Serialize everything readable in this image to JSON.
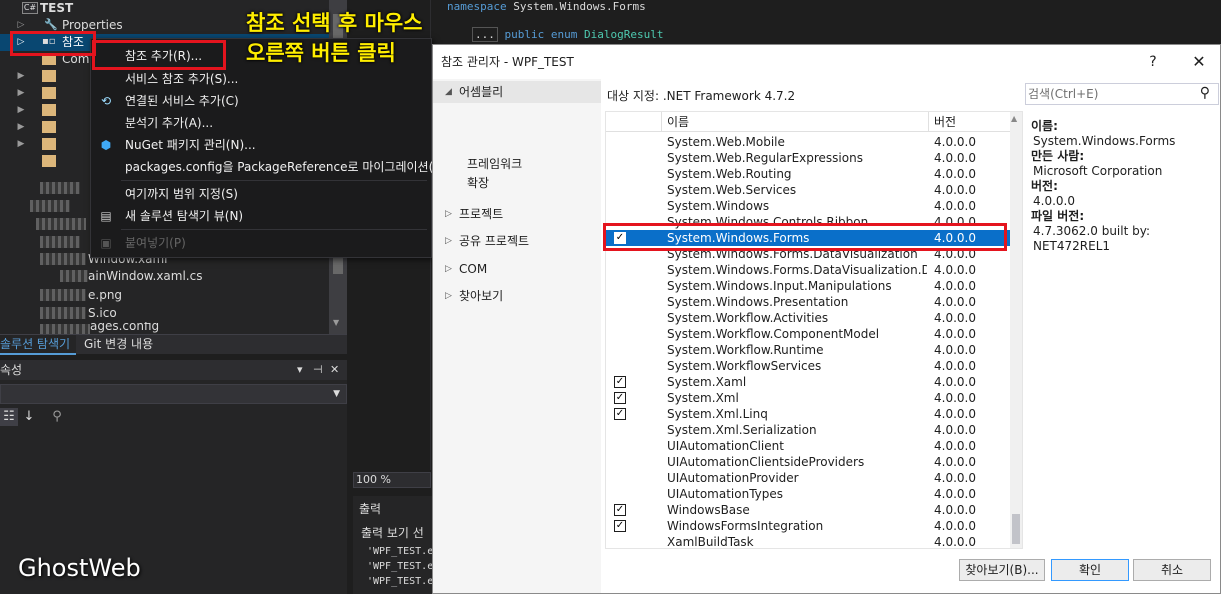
{
  "solution_explorer": {
    "project_name": "TEST",
    "project_badge": "C#",
    "items": {
      "properties": "Properties",
      "references": "참조",
      "common": "Com",
      "mainwindow_xaml": "Window.xaml",
      "mainwindow_cs": "ainWindow.xaml.cs",
      "png": "e.png",
      "ico": "S.ico",
      "packages": "ages.config"
    },
    "tabs": {
      "solution": "솔루션 탐색기",
      "git": "Git 변경 내용"
    }
  },
  "properties_panel": {
    "title": "속성"
  },
  "editor": {
    "namespace_keyword": "namespace",
    "namespace_name": "System.Windows.Forms",
    "enum_prefix": "...",
    "enum_keywords": "public enum",
    "enum_name": "DialogResult",
    "zoom": "100 %",
    "output_title": "출력",
    "output_source": "출력 보기 선",
    "output_lines": [
      "'WPF_TEST.e",
      "'WPF_TEST.e",
      "'WPF_TEST.e"
    ]
  },
  "context_menu": {
    "items": [
      {
        "label": "참조 추가(R)...",
        "icon": ""
      },
      {
        "label": "서비스 참조 추가(S)...",
        "icon": ""
      },
      {
        "label": "연결된 서비스 추가(C)",
        "icon": "connected-service-icon"
      },
      {
        "label": "분석기 추가(A)...",
        "icon": ""
      },
      {
        "label": "NuGet 패키지 관리(N)...",
        "icon": "nuget-icon"
      },
      {
        "label": "packages.config을 PackageReference로 마이그레이션(M)",
        "icon": ""
      },
      {
        "label": "여기까지 범위 지정(S)",
        "icon": ""
      },
      {
        "label": "새 솔루션 탐색기 뷰(N)",
        "icon": "new-explorer-view-icon"
      },
      {
        "label": "붙여넣기(P)",
        "icon": "paste-icon"
      }
    ]
  },
  "annotation": {
    "line1": "참조 선택 후 마우스",
    "line2": "오른쪽 버튼 클릭"
  },
  "watermark": "GhostWeb",
  "dialog": {
    "title": "참조 관리자 - WPF_TEST",
    "help": "?",
    "close": "✕",
    "target_label": "대상 지정: .NET Framework 4.7.2",
    "search_placeholder": "검색(Ctrl+E)",
    "nav": {
      "assemblies": "어셈블리",
      "framework": "프레임워크",
      "extensions": "확장",
      "projects": "프로젝트",
      "shared_projects": "공유 프로젝트",
      "com": "COM",
      "browse": "찾아보기"
    },
    "columns": {
      "name": "이름",
      "version": "버전"
    },
    "rows": [
      {
        "name": "System.Web.Mobile",
        "version": "4.0.0.0",
        "checked": false,
        "selected": false
      },
      {
        "name": "System.Web.RegularExpressions",
        "version": "4.0.0.0",
        "checked": false,
        "selected": false
      },
      {
        "name": "System.Web.Routing",
        "version": "4.0.0.0",
        "checked": false,
        "selected": false
      },
      {
        "name": "System.Web.Services",
        "version": "4.0.0.0",
        "checked": false,
        "selected": false
      },
      {
        "name": "System.Windows",
        "version": "4.0.0.0",
        "checked": false,
        "selected": false
      },
      {
        "name": "System.Windows.Controls.Ribbon",
        "version": "4.0.0.0",
        "checked": false,
        "selected": false
      },
      {
        "name": "System.Windows.Forms",
        "version": "4.0.0.0",
        "checked": true,
        "selected": true
      },
      {
        "name": "System.Windows.Forms.DataVisualization",
        "version": "4.0.0.0",
        "checked": false,
        "selected": false
      },
      {
        "name": "System.Windows.Forms.DataVisualization.Des...",
        "version": "4.0.0.0",
        "checked": false,
        "selected": false
      },
      {
        "name": "System.Windows.Input.Manipulations",
        "version": "4.0.0.0",
        "checked": false,
        "selected": false
      },
      {
        "name": "System.Windows.Presentation",
        "version": "4.0.0.0",
        "checked": false,
        "selected": false
      },
      {
        "name": "System.Workflow.Activities",
        "version": "4.0.0.0",
        "checked": false,
        "selected": false
      },
      {
        "name": "System.Workflow.ComponentModel",
        "version": "4.0.0.0",
        "checked": false,
        "selected": false
      },
      {
        "name": "System.Workflow.Runtime",
        "version": "4.0.0.0",
        "checked": false,
        "selected": false
      },
      {
        "name": "System.WorkflowServices",
        "version": "4.0.0.0",
        "checked": false,
        "selected": false
      },
      {
        "name": "System.Xaml",
        "version": "4.0.0.0",
        "checked": true,
        "selected": false
      },
      {
        "name": "System.Xml",
        "version": "4.0.0.0",
        "checked": true,
        "selected": false
      },
      {
        "name": "System.Xml.Linq",
        "version": "4.0.0.0",
        "checked": true,
        "selected": false
      },
      {
        "name": "System.Xml.Serialization",
        "version": "4.0.0.0",
        "checked": false,
        "selected": false
      },
      {
        "name": "UIAutomationClient",
        "version": "4.0.0.0",
        "checked": false,
        "selected": false
      },
      {
        "name": "UIAutomationClientsideProviders",
        "version": "4.0.0.0",
        "checked": false,
        "selected": false
      },
      {
        "name": "UIAutomationProvider",
        "version": "4.0.0.0",
        "checked": false,
        "selected": false
      },
      {
        "name": "UIAutomationTypes",
        "version": "4.0.0.0",
        "checked": false,
        "selected": false
      },
      {
        "name": "WindowsBase",
        "version": "4.0.0.0",
        "checked": true,
        "selected": false
      },
      {
        "name": "WindowsFormsIntegration",
        "version": "4.0.0.0",
        "checked": true,
        "selected": false
      },
      {
        "name": "XamlBuildTask",
        "version": "4.0.0.0",
        "checked": false,
        "selected": false
      }
    ],
    "details": {
      "name_label": "이름:",
      "name_value": "System.Windows.Forms",
      "author_label": "만든 사람:",
      "author_value": "Microsoft Corporation",
      "version_label": "버전:",
      "version_value": "4.0.0.0",
      "file_version_label": "파일 버전:",
      "file_version_value": "4.7.3062.0 built by: NET472REL1"
    },
    "buttons": {
      "browse": "찾아보기(B)...",
      "ok": "확인",
      "cancel": "취소"
    }
  },
  "colors": {
    "accent": "#0a6fc9",
    "highlight_box": "#e4141e",
    "annotation": "#ffee00"
  }
}
